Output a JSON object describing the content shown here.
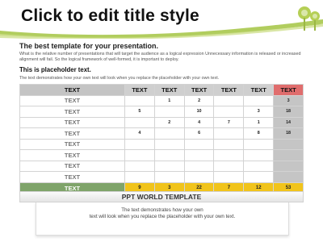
{
  "slide": {
    "title": "Click to edit title style",
    "intro_heading": "The best template for your presentation.",
    "intro_body": "What is the relative number of presentations that will target the audience as a logical expression Unnecessary information is released or increased alignment will fail. So the logical framework of well-formed, it is important to deploy.",
    "section_title": "This is placeholder text.",
    "section_body": "The text demonstrates how your own text will look when you replace the placeholder with your own text."
  },
  "table": {
    "headers": [
      "TEXT",
      "TEXT",
      "TEXT",
      "TEXT",
      "TEXT",
      "TEXT",
      "TEXT"
    ],
    "rows": [
      [
        "TEXT",
        "",
        "1",
        "2",
        "",
        "",
        "3"
      ],
      [
        "TEXT",
        "5",
        "",
        "10",
        "",
        "3",
        "18"
      ],
      [
        "TEXT",
        "",
        "2",
        "4",
        "7",
        "1",
        "14"
      ],
      [
        "TEXT",
        "4",
        "",
        "6",
        "",
        "8",
        "18"
      ],
      [
        "TEXT",
        "",
        "",
        "",
        "",
        "",
        ""
      ],
      [
        "TEXT",
        "",
        "",
        "",
        "",
        "",
        ""
      ],
      [
        "TEXT",
        "",
        "",
        "",
        "",
        "",
        ""
      ],
      [
        "TEXT",
        "",
        "",
        "",
        "",
        "",
        ""
      ]
    ],
    "total": [
      "TEXT",
      "9",
      "3",
      "22",
      "7",
      "12",
      "53"
    ]
  },
  "callout": {
    "title": "PPT WORLD TEMPLATE",
    "line1": "The text demonstrates how your own",
    "line2": "text will look when you replace the placeholder with your own text."
  },
  "colors": {
    "header_gray": "#cfcfcf",
    "header_red": "#e06d6d",
    "total_yellow": "#f1c41b",
    "total_green": "#7fa46a",
    "wave_green": "#a9c84d",
    "last_col_gray": "#c5c5c5"
  },
  "icons": [
    "tree-icon"
  ]
}
